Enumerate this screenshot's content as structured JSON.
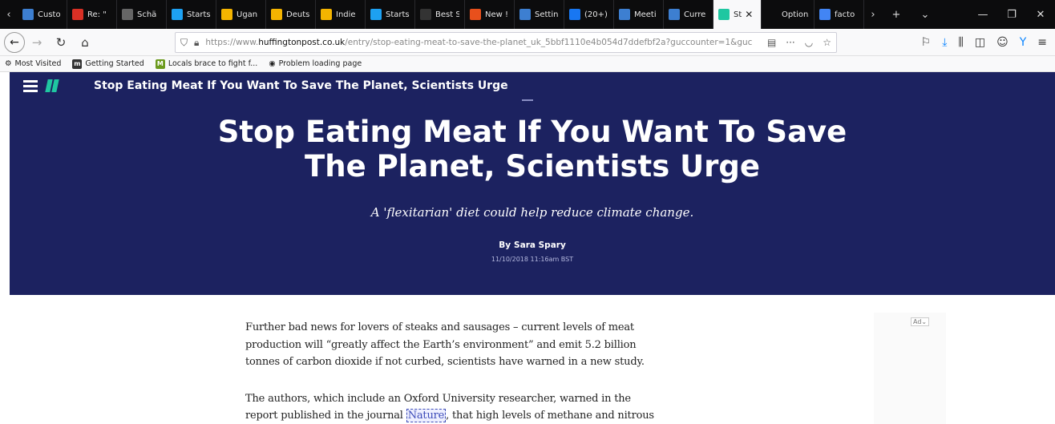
{
  "tabs": [
    {
      "title": "Custo",
      "icon_color": "#3d7fd1"
    },
    {
      "title": "Re: \"",
      "icon_color": "#d93025"
    },
    {
      "title": "Schä",
      "icon_color": "#666666"
    },
    {
      "title": "Startse",
      "icon_color": "#1da1f2"
    },
    {
      "title": "Ugan",
      "icon_color": "#f4b400"
    },
    {
      "title": "Deuts",
      "icon_color": "#f4b400"
    },
    {
      "title": "Indie",
      "icon_color": "#f4b400"
    },
    {
      "title": "Startse",
      "icon_color": "#1da1f2"
    },
    {
      "title": "Best S",
      "icon_color": "#333333"
    },
    {
      "title": "New !",
      "icon_color": "#e8501c"
    },
    {
      "title": "Settin",
      "icon_color": "#3d7fd1"
    },
    {
      "title": "(20+)",
      "icon_color": "#1877f2"
    },
    {
      "title": "Meeti",
      "icon_color": "#3d7fd1"
    },
    {
      "title": "Curre",
      "icon_color": "#3d7fd1"
    },
    {
      "title": "St",
      "icon_color": "#1fc7a1",
      "active": true
    },
    {
      "title": "Options fo",
      "icon_color": "#0c0c0d"
    },
    {
      "title": "facto",
      "icon_color": "#4285f4"
    }
  ],
  "nav": {
    "url_prefix": "https://www.",
    "url_domain": "huffingtonpost.co.uk",
    "url_rest": "/entry/stop-eating-meat-to-save-the-planet_uk_5bbf1110e4b054d7ddefbf2a?guccounter=1&guc",
    "more": "···"
  },
  "bookmarks": [
    {
      "label": "Most Visited",
      "icon": "gear-icon"
    },
    {
      "label": "Getting Started",
      "icon": "getting-started-icon"
    },
    {
      "label": "Locals brace to fight f...",
      "icon": "news-icon"
    },
    {
      "label": "Problem loading page",
      "icon": "globe-icon"
    }
  ],
  "hero": {
    "sticky_title": "Stop Eating Meat If You Want To Save The Planet, Scientists Urge",
    "headline_line1": "Stop Eating Meat If You Want To Save",
    "headline_line2": "The Planet, Scientists Urge",
    "subhead": "A 'flexitarian' diet could help reduce climate change.",
    "by": "By",
    "author": "Sara Spary",
    "date": "11/10/2018 11:16am BST",
    "bg_color": "#1c2260",
    "accent_color": "#1fc7a1"
  },
  "article": {
    "p1": "Further bad news for lovers of steaks and sausages – current levels of meat production will “greatly affect the Earth’s environment” and emit 5.2 billion tonnes of carbon dioxide if not curbed, scientists have warned in a new study.",
    "p2_before": "The authors, which include an Oxford University researcher, warned in the report published in the journal ",
    "p2_link": "Nature",
    "p2_after": ", that high levels of methane and nitrous"
  },
  "ad": {
    "label": "Ad"
  }
}
